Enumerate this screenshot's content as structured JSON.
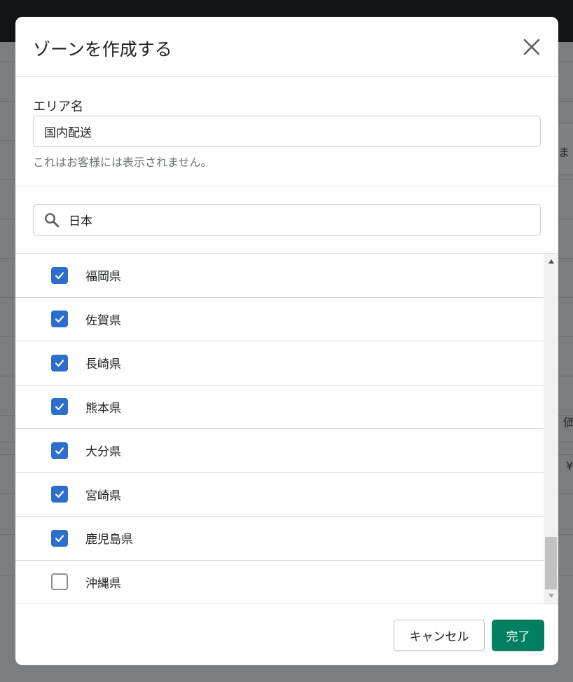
{
  "background": {
    "fragment_right_top": "ま",
    "fragment_price": "価",
    "fragment_yen": "¥"
  },
  "modal": {
    "title": "ゾーンを作成する",
    "close_icon": "close-icon"
  },
  "area_name": {
    "label": "エリア名",
    "value": "国内配送",
    "help": "これはお客様には表示されません。"
  },
  "search": {
    "icon": "search-icon",
    "value": "日本"
  },
  "list": {
    "items": [
      {
        "label": "福岡県",
        "checked": true
      },
      {
        "label": "佐賀県",
        "checked": true
      },
      {
        "label": "長崎県",
        "checked": true
      },
      {
        "label": "熊本県",
        "checked": true
      },
      {
        "label": "大分県",
        "checked": true
      },
      {
        "label": "宮崎県",
        "checked": true
      },
      {
        "label": "鹿児島県",
        "checked": true
      },
      {
        "label": "沖縄県",
        "checked": false
      }
    ]
  },
  "footer": {
    "cancel_label": "キャンセル",
    "done_label": "完了"
  },
  "colors": {
    "accent_checkbox": "#2c6ecb",
    "primary_button": "#008060"
  }
}
